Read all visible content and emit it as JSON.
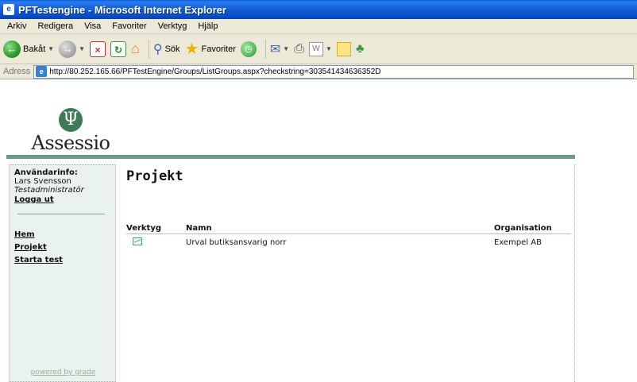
{
  "window": {
    "title": "PFTestengine - Microsoft Internet Explorer"
  },
  "menu": [
    "Arkiv",
    "Redigera",
    "Visa",
    "Favoriter",
    "Verktyg",
    "Hjälp"
  ],
  "toolbar": {
    "back_label": "Bakåt",
    "search_label": "Sök",
    "favorites_label": "Favoriter"
  },
  "address": {
    "label": "Adress",
    "url": "http://80.252.165.66/PFTestEngine/Groups/ListGroups.aspx?checkstring=303541434636352D"
  },
  "logo": {
    "symbol": "Ψ",
    "brand": "Assessio"
  },
  "sidebar": {
    "userinfo_header": "Användarinfo:",
    "user_name": "Lars Svensson",
    "user_role": "Testadministratör",
    "logout": "Logga ut",
    "nav": [
      "Hem",
      "Projekt",
      "Starta test"
    ],
    "powered_by": "powered by grade"
  },
  "main": {
    "title": "Projekt",
    "table": {
      "headers": [
        "Verktyg",
        "Namn",
        "Organisation"
      ],
      "rows": [
        {
          "tool_icon": "chart-icon",
          "name": "Urval butiksansvarig norr",
          "organisation": "Exempel AB"
        }
      ]
    }
  }
}
